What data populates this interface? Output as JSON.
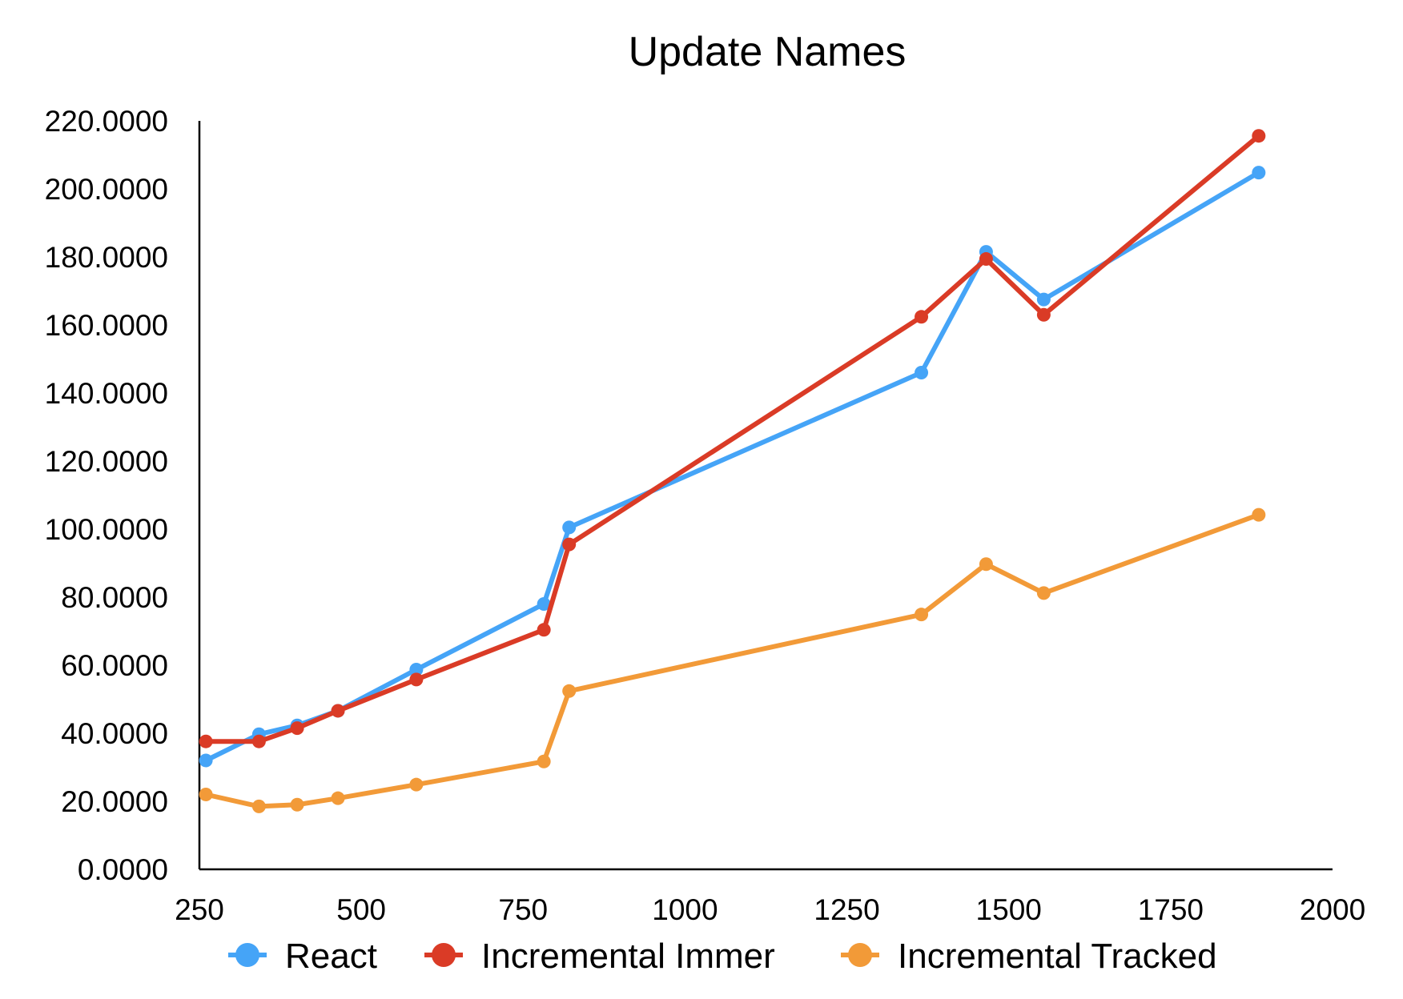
{
  "chart_data": {
    "type": "line",
    "title": "Update Names",
    "xlabel": "",
    "ylabel": "",
    "xlim": [
      250,
      2000
    ],
    "ylim": [
      0,
      220
    ],
    "x_ticks": [
      250,
      500,
      750,
      1000,
      1250,
      1500,
      1750,
      2000
    ],
    "y_ticks": [
      0,
      20,
      40,
      60,
      80,
      100,
      120,
      140,
      160,
      180,
      200,
      220
    ],
    "y_tick_labels": [
      "0.0000",
      "20.0000",
      "40.0000",
      "60.0000",
      "80.0000",
      "100.0000",
      "120.0000",
      "140.0000",
      "160.0000",
      "180.0000",
      "200.0000",
      "220.0000"
    ],
    "x_tick_labels": [
      "250",
      "500",
      "750",
      "1000",
      "1250",
      "1500",
      "1750",
      "2000"
    ],
    "grid": false,
    "legend_position": "bottom",
    "x": [
      260,
      342,
      401,
      464,
      585,
      782,
      821,
      1365,
      1465,
      1554,
      1886
    ],
    "series": [
      {
        "name": "React",
        "color": "#45a4f7",
        "values": [
          32.0,
          39.7,
          42.3,
          46.6,
          58.7,
          78.0,
          100.5,
          146.0,
          181.5,
          167.5,
          204.8
        ]
      },
      {
        "name": "Incremental Immer",
        "color": "#da3b26",
        "values": [
          37.6,
          37.6,
          41.5,
          46.6,
          55.8,
          70.4,
          95.5,
          162.4,
          179.4,
          163.0,
          215.6
        ]
      },
      {
        "name": "Incremental Tracked",
        "color": "#f29a38",
        "values": [
          22.0,
          18.5,
          19.0,
          20.9,
          24.9,
          31.7,
          52.4,
          74.9,
          89.7,
          81.2,
          104.2
        ]
      }
    ]
  }
}
